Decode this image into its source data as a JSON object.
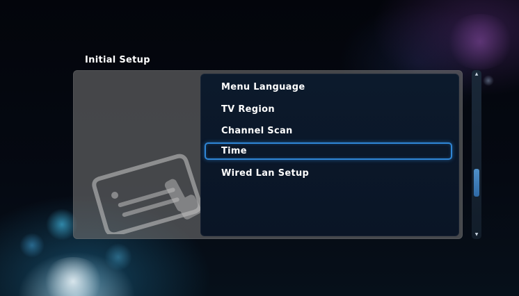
{
  "header": {
    "title": "Initial Setup"
  },
  "menu": {
    "items": [
      {
        "label": "Menu Language"
      },
      {
        "label": "TV Region"
      },
      {
        "label": "Channel Scan"
      },
      {
        "label": "Time"
      },
      {
        "label": "Wired Lan Setup"
      }
    ],
    "selected_index": 3
  },
  "scroll": {
    "up_arrow": "▲",
    "down_arrow": "▼",
    "position_fraction": 0.6
  },
  "colors": {
    "selection_border": "#2f86d6",
    "menu_background": "#0c1a2c",
    "panel_background": "#6e6e6e",
    "text": "#ffffff"
  },
  "icons": {
    "setup_illustration": "settings-card-icon"
  }
}
